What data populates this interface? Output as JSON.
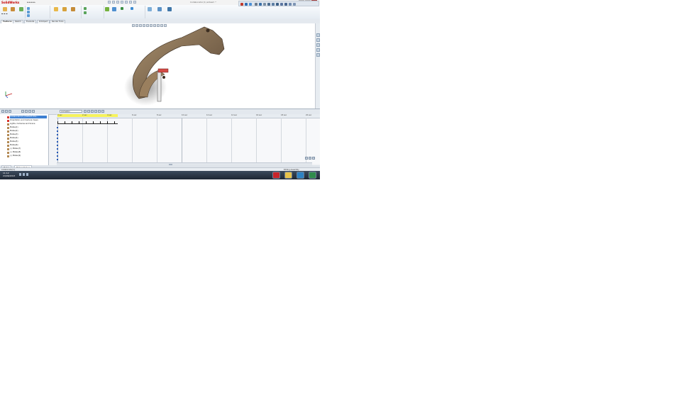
{
  "app": {
    "name": "SolidWorks",
    "document_title": "Collaborator(1).sldasm *",
    "search_placeholder": "Search"
  },
  "tabs": [
    "Features",
    "Sketch",
    "Evaluate",
    "DimXpert",
    "Render Tools"
  ],
  "active_tab": "Features",
  "motion_study": {
    "study_type": "Animation",
    "tree_items": [
      "Collaborator(1) (Default<Dis...",
      "Orientation and Camera Views",
      "Lights, Cameras and Scene",
      "Mates(1)",
      "Mates(2)",
      "Mates(3)",
      "Mates(4)",
      "Mates(5)",
      "Mates(6)",
      "(-) Mates(7)",
      "(-) Mates(8)",
      "(-) Mates(9)"
    ],
    "selected_item": "Collaborator(1) (Default<Dis..."
  },
  "bottom_tabs": [
    "Model",
    "Motion Study 1"
  ],
  "status": {
    "left": "Collaborator(1)",
    "right": "Editing Assembly"
  },
  "taskbar": {
    "time": "11:12",
    "date": "24/06/2013"
  },
  "icons": [
    "solidworks-logo-icon",
    "new-icon",
    "open-icon",
    "save-icon",
    "print-icon",
    "undo-icon",
    "rebuild-icon",
    "options-icon",
    "zoom-to-fit-icon",
    "section-view-icon",
    "play-icon",
    "stop-icon",
    "key-icon"
  ]
}
